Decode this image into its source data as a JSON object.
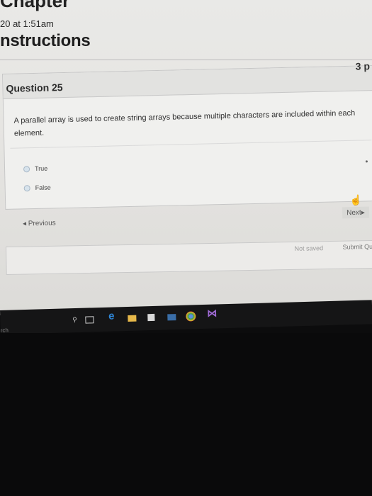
{
  "page": {
    "header_fragment": "Chapter",
    "submitted_time": "20 at 1:51am",
    "heading": "nstructions"
  },
  "question": {
    "title": "Question 25",
    "points": "3 p",
    "text": "A parallel array is used to create string arrays because multiple characters are included within each element.",
    "answers": [
      {
        "label": "True",
        "selected": false
      },
      {
        "label": "False",
        "selected": false
      }
    ]
  },
  "nav": {
    "previous_label": "Previous",
    "next_label": "Next"
  },
  "footer": {
    "status": "Not saved",
    "submit_label": "Submit Qui"
  },
  "taskbar": {
    "search_fragment": "rch",
    "icons": [
      "microphone-icon",
      "task-view-icon",
      "edge-icon",
      "folder-icon",
      "store-icon",
      "mail-icon",
      "chrome-icon",
      "visual-studio-icon"
    ]
  }
}
